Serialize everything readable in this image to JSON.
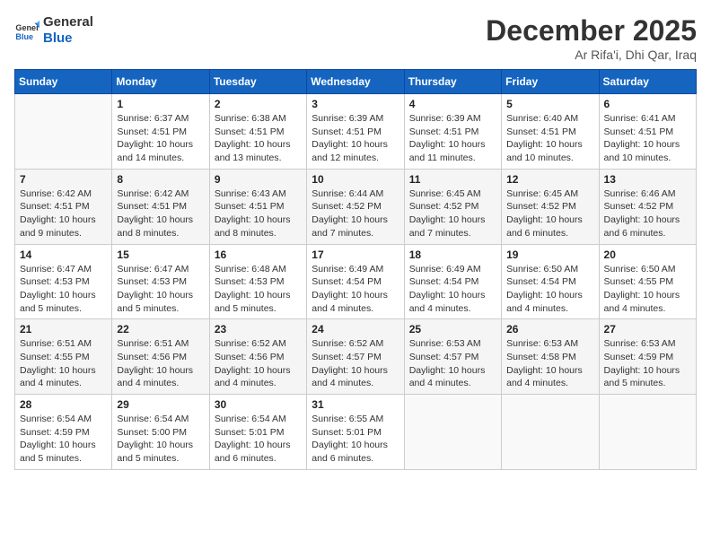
{
  "header": {
    "logo_line1": "General",
    "logo_line2": "Blue",
    "month": "December 2025",
    "location": "Ar Rifa'i, Dhi Qar, Iraq"
  },
  "weekdays": [
    "Sunday",
    "Monday",
    "Tuesday",
    "Wednesday",
    "Thursday",
    "Friday",
    "Saturday"
  ],
  "weeks": [
    [
      {
        "day": "",
        "info": ""
      },
      {
        "day": "1",
        "info": "Sunrise: 6:37 AM\nSunset: 4:51 PM\nDaylight: 10 hours\nand 14 minutes."
      },
      {
        "day": "2",
        "info": "Sunrise: 6:38 AM\nSunset: 4:51 PM\nDaylight: 10 hours\nand 13 minutes."
      },
      {
        "day": "3",
        "info": "Sunrise: 6:39 AM\nSunset: 4:51 PM\nDaylight: 10 hours\nand 12 minutes."
      },
      {
        "day": "4",
        "info": "Sunrise: 6:39 AM\nSunset: 4:51 PM\nDaylight: 10 hours\nand 11 minutes."
      },
      {
        "day": "5",
        "info": "Sunrise: 6:40 AM\nSunset: 4:51 PM\nDaylight: 10 hours\nand 10 minutes."
      },
      {
        "day": "6",
        "info": "Sunrise: 6:41 AM\nSunset: 4:51 PM\nDaylight: 10 hours\nand 10 minutes."
      }
    ],
    [
      {
        "day": "7",
        "info": "Sunrise: 6:42 AM\nSunset: 4:51 PM\nDaylight: 10 hours\nand 9 minutes."
      },
      {
        "day": "8",
        "info": "Sunrise: 6:42 AM\nSunset: 4:51 PM\nDaylight: 10 hours\nand 8 minutes."
      },
      {
        "day": "9",
        "info": "Sunrise: 6:43 AM\nSunset: 4:51 PM\nDaylight: 10 hours\nand 8 minutes."
      },
      {
        "day": "10",
        "info": "Sunrise: 6:44 AM\nSunset: 4:52 PM\nDaylight: 10 hours\nand 7 minutes."
      },
      {
        "day": "11",
        "info": "Sunrise: 6:45 AM\nSunset: 4:52 PM\nDaylight: 10 hours\nand 7 minutes."
      },
      {
        "day": "12",
        "info": "Sunrise: 6:45 AM\nSunset: 4:52 PM\nDaylight: 10 hours\nand 6 minutes."
      },
      {
        "day": "13",
        "info": "Sunrise: 6:46 AM\nSunset: 4:52 PM\nDaylight: 10 hours\nand 6 minutes."
      }
    ],
    [
      {
        "day": "14",
        "info": "Sunrise: 6:47 AM\nSunset: 4:53 PM\nDaylight: 10 hours\nand 5 minutes."
      },
      {
        "day": "15",
        "info": "Sunrise: 6:47 AM\nSunset: 4:53 PM\nDaylight: 10 hours\nand 5 minutes."
      },
      {
        "day": "16",
        "info": "Sunrise: 6:48 AM\nSunset: 4:53 PM\nDaylight: 10 hours\nand 5 minutes."
      },
      {
        "day": "17",
        "info": "Sunrise: 6:49 AM\nSunset: 4:54 PM\nDaylight: 10 hours\nand 4 minutes."
      },
      {
        "day": "18",
        "info": "Sunrise: 6:49 AM\nSunset: 4:54 PM\nDaylight: 10 hours\nand 4 minutes."
      },
      {
        "day": "19",
        "info": "Sunrise: 6:50 AM\nSunset: 4:54 PM\nDaylight: 10 hours\nand 4 minutes."
      },
      {
        "day": "20",
        "info": "Sunrise: 6:50 AM\nSunset: 4:55 PM\nDaylight: 10 hours\nand 4 minutes."
      }
    ],
    [
      {
        "day": "21",
        "info": "Sunrise: 6:51 AM\nSunset: 4:55 PM\nDaylight: 10 hours\nand 4 minutes."
      },
      {
        "day": "22",
        "info": "Sunrise: 6:51 AM\nSunset: 4:56 PM\nDaylight: 10 hours\nand 4 minutes."
      },
      {
        "day": "23",
        "info": "Sunrise: 6:52 AM\nSunset: 4:56 PM\nDaylight: 10 hours\nand 4 minutes."
      },
      {
        "day": "24",
        "info": "Sunrise: 6:52 AM\nSunset: 4:57 PM\nDaylight: 10 hours\nand 4 minutes."
      },
      {
        "day": "25",
        "info": "Sunrise: 6:53 AM\nSunset: 4:57 PM\nDaylight: 10 hours\nand 4 minutes."
      },
      {
        "day": "26",
        "info": "Sunrise: 6:53 AM\nSunset: 4:58 PM\nDaylight: 10 hours\nand 4 minutes."
      },
      {
        "day": "27",
        "info": "Sunrise: 6:53 AM\nSunset: 4:59 PM\nDaylight: 10 hours\nand 5 minutes."
      }
    ],
    [
      {
        "day": "28",
        "info": "Sunrise: 6:54 AM\nSunset: 4:59 PM\nDaylight: 10 hours\nand 5 minutes."
      },
      {
        "day": "29",
        "info": "Sunrise: 6:54 AM\nSunset: 5:00 PM\nDaylight: 10 hours\nand 5 minutes."
      },
      {
        "day": "30",
        "info": "Sunrise: 6:54 AM\nSunset: 5:01 PM\nDaylight: 10 hours\nand 6 minutes."
      },
      {
        "day": "31",
        "info": "Sunrise: 6:55 AM\nSunset: 5:01 PM\nDaylight: 10 hours\nand 6 minutes."
      },
      {
        "day": "",
        "info": ""
      },
      {
        "day": "",
        "info": ""
      },
      {
        "day": "",
        "info": ""
      }
    ]
  ]
}
